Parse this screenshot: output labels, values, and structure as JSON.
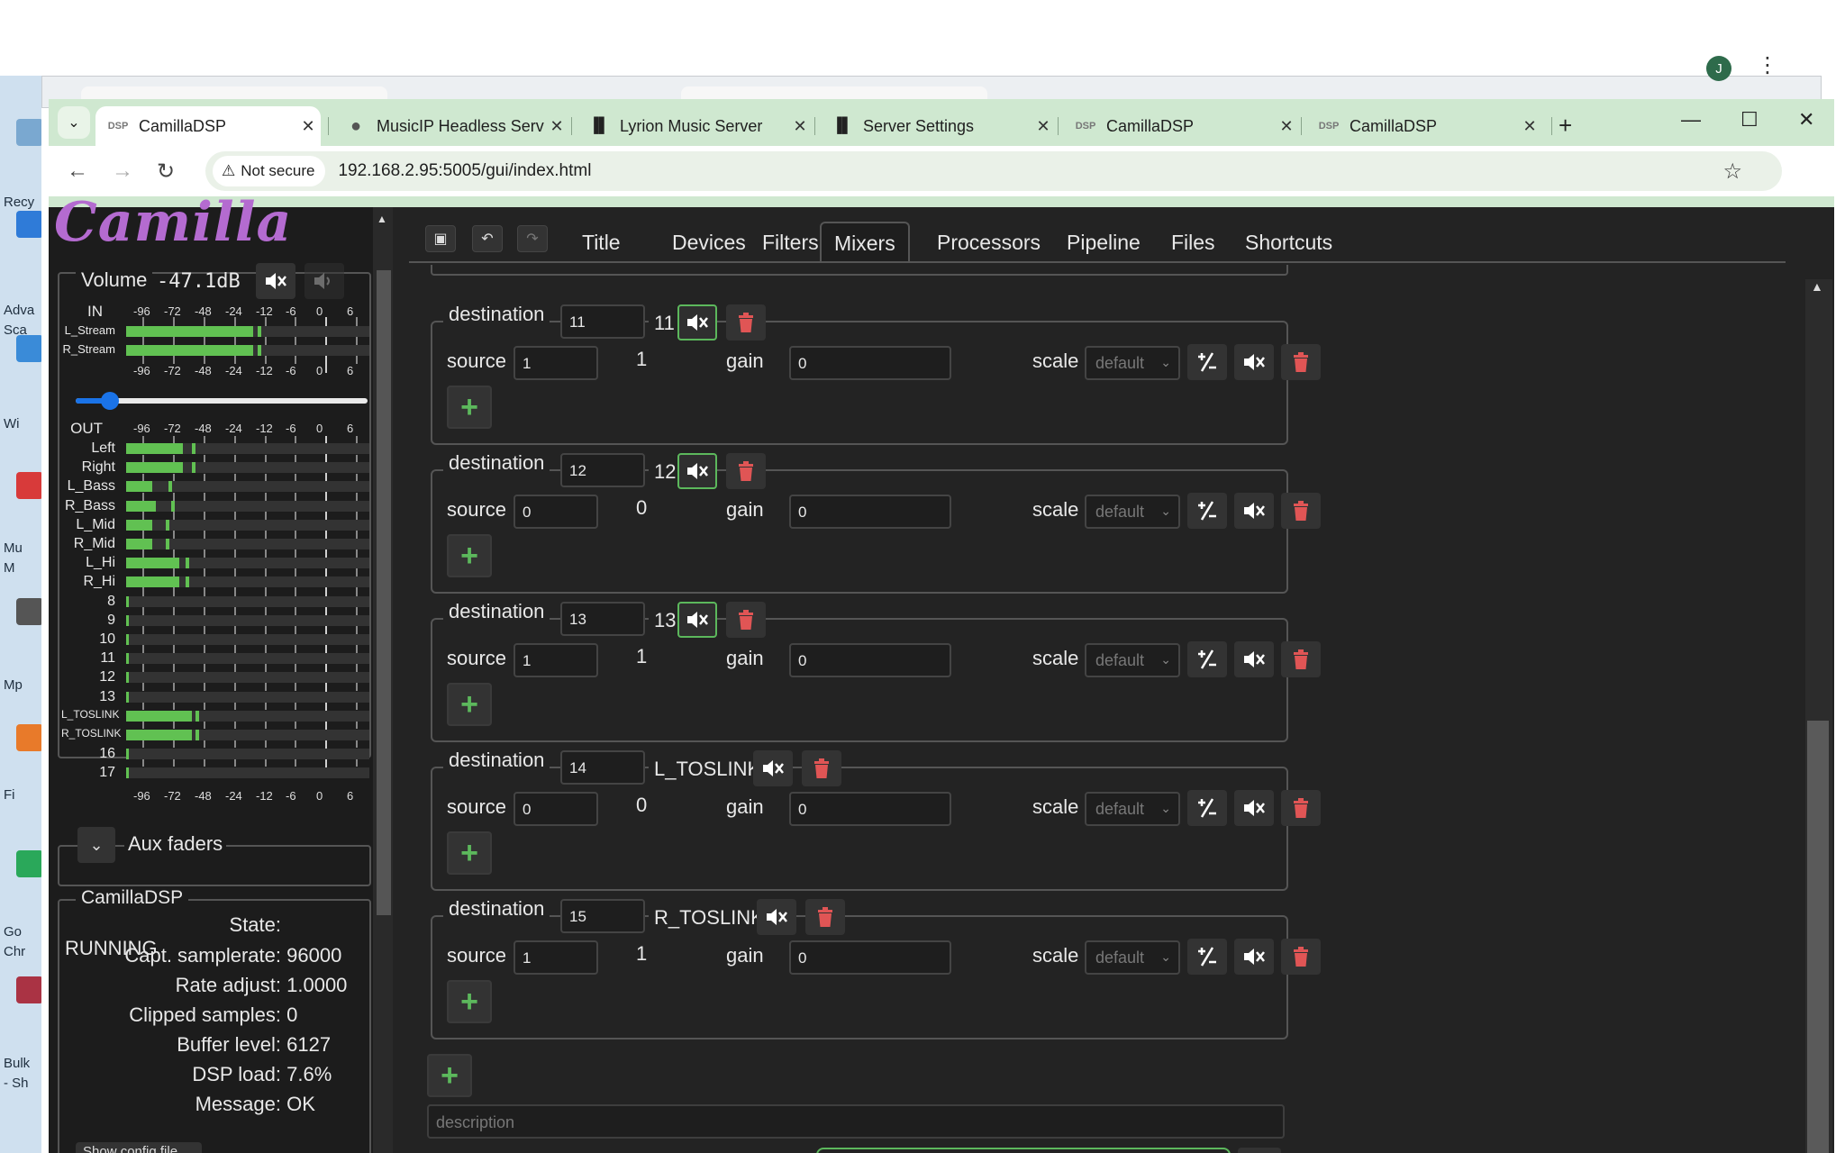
{
  "desktop": {
    "labels": [
      "Recy",
      "Adva",
      "Sca",
      "Wi",
      "Mu",
      "M",
      "Mp",
      "Fi",
      "Go",
      "Chr",
      "Bulk",
      "- Sh"
    ]
  },
  "browser": {
    "tabs": [
      {
        "title": "CamillaDSP",
        "icon": "dsp-favicon"
      },
      {
        "title": "MusicIP Headless Serv",
        "icon": "globe-icon"
      },
      {
        "title": "Lyrion Music Server",
        "icon": "lyrion-icon"
      },
      {
        "title": "Server Settings",
        "icon": "lyrion-icon"
      },
      {
        "title": "CamillaDSP",
        "icon": "dsp-favicon"
      },
      {
        "title": "CamillaDSP",
        "icon": "dsp-favicon"
      }
    ],
    "security_label": "Not secure",
    "url": "192.168.2.95:5005/gui/index.html",
    "avatar_letter": "J"
  },
  "left_panel": {
    "logo_text": "Camilla",
    "volume_label": "Volume",
    "volume_value": "-47.1dB",
    "volume_percent": 8,
    "scale_ticks": [
      "-96",
      "-72",
      "-48",
      "-24",
      "-12",
      "-6",
      "0",
      "6"
    ],
    "in_label": "IN",
    "out_label": "OUT",
    "in_channels": [
      {
        "name": "L_Stream",
        "level_db": -16,
        "peak_db": -14
      },
      {
        "name": "R_Stream",
        "level_db": -16,
        "peak_db": -14
      }
    ],
    "out_channels": [
      {
        "name": "Left",
        "level_db": -63,
        "peak_db": -56
      },
      {
        "name": "Right",
        "level_db": -63,
        "peak_db": -56
      },
      {
        "name": "L_Bass",
        "level_db": -87,
        "peak_db": -74
      },
      {
        "name": "R_Bass",
        "level_db": -84,
        "peak_db": -72
      },
      {
        "name": "L_Mid",
        "level_db": -87,
        "peak_db": -76
      },
      {
        "name": "R_Mid",
        "level_db": -87,
        "peak_db": -76
      },
      {
        "name": "L_Hi",
        "level_db": -66,
        "peak_db": -61
      },
      {
        "name": "R_Hi",
        "level_db": -66,
        "peak_db": -61
      },
      {
        "name": "8",
        "level_db": null,
        "peak_db": null
      },
      {
        "name": "9",
        "level_db": null,
        "peak_db": null
      },
      {
        "name": "10",
        "level_db": null,
        "peak_db": null
      },
      {
        "name": "11",
        "level_db": null,
        "peak_db": null
      },
      {
        "name": "12",
        "level_db": null,
        "peak_db": null
      },
      {
        "name": "13",
        "level_db": null,
        "peak_db": null
      },
      {
        "name": "L_TOSLINK",
        "level_db": -56,
        "peak_db": -53
      },
      {
        "name": "R_TOSLINK",
        "level_db": -56,
        "peak_db": -53
      },
      {
        "name": "16",
        "level_db": null,
        "peak_db": null
      },
      {
        "name": "17",
        "level_db": null,
        "peak_db": null
      }
    ],
    "aux_faders_label": "Aux faders",
    "status": {
      "title": "CamillaDSP",
      "rows": [
        {
          "key": "State:",
          "value": "RUNNING"
        },
        {
          "key": "Capt. samplerate:",
          "value": "96000"
        },
        {
          "key": "Rate adjust:",
          "value": "1.0000"
        },
        {
          "key": "Clipped samples:",
          "value": "0"
        },
        {
          "key": "Buffer level:",
          "value": "6127"
        },
        {
          "key": "DSP load:",
          "value": "7.6%"
        },
        {
          "key": "Message:",
          "value": "OK"
        }
      ],
      "partial_button": "Show config file"
    }
  },
  "nav_tabs": [
    "Title",
    "Devices",
    "Filters",
    "Mixers",
    "Processors",
    "Pipeline",
    "Files",
    "Shortcuts"
  ],
  "active_tab": "Mixers",
  "mixer": {
    "destination_label": "destination",
    "source_label": "source",
    "gain_label": "gain",
    "scale_label": "scale",
    "destinations": [
      {
        "dest": "11",
        "name": "11",
        "muted": true,
        "source": "1",
        "source_name": "1",
        "gain": "0",
        "scale": "default"
      },
      {
        "dest": "12",
        "name": "12",
        "muted": true,
        "source": "0",
        "source_name": "0",
        "gain": "0",
        "scale": "default"
      },
      {
        "dest": "13",
        "name": "13",
        "muted": true,
        "source": "1",
        "source_name": "1",
        "gain": "0",
        "scale": "default"
      },
      {
        "dest": "14",
        "name": "L_TOSLINK",
        "muted": false,
        "source": "0",
        "source_name": "0",
        "gain": "0",
        "scale": "default"
      },
      {
        "dest": "15",
        "name": "R_TOSLINK",
        "muted": false,
        "source": "1",
        "source_name": "1",
        "gain": "0",
        "scale": "default"
      }
    ],
    "description_placeholder": "description"
  }
}
